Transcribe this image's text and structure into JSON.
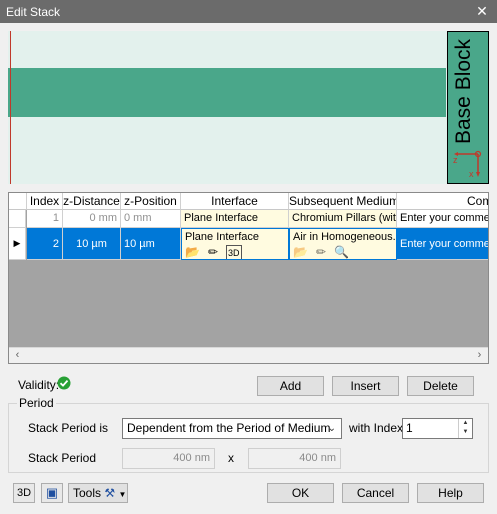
{
  "window": {
    "title": "Edit Stack",
    "close_glyph": "✕"
  },
  "preview": {
    "base_block_label": "Base Block",
    "axis_z": "z",
    "axis_x": "x",
    "layer_color": "#4aa78a",
    "background_color": "#e3f1ed"
  },
  "table": {
    "headers": [
      "Index",
      "z-Distance",
      "z-Position",
      "Interface",
      "Subsequent Medium",
      "Comment"
    ],
    "rows": [
      {
        "index": "1",
        "z_distance": "0 mm",
        "z_position": "0 mm",
        "interface": "Plane Interface",
        "medium": "Chromium Pillars (with",
        "comment": "Enter your comment"
      },
      {
        "index": "2",
        "z_distance": "10 µm",
        "z_position": "10 µm",
        "interface": "Plane Interface",
        "medium": "Air in Homogeneous...",
        "comment": "Enter your comment"
      }
    ],
    "selected_row": 2,
    "header_display": {
      "comment": "Com"
    }
  },
  "validity": {
    "label": "Validity:",
    "status": "valid",
    "status_color": "#27a034"
  },
  "actions": {
    "add": "Add",
    "insert": "Insert",
    "delete": "Delete"
  },
  "period": {
    "legend": "Period",
    "stack_period_is_label": "Stack Period is",
    "stack_period_is_value": "Dependent from the Period of Medium",
    "with_index_label": "with Index",
    "with_index_value": "1",
    "stack_period_label": "Stack Period",
    "period_x": "400 nm",
    "times": "x",
    "period_y": "400 nm"
  },
  "footer": {
    "tools": "Tools",
    "ok": "OK",
    "cancel": "Cancel",
    "help": "Help"
  }
}
